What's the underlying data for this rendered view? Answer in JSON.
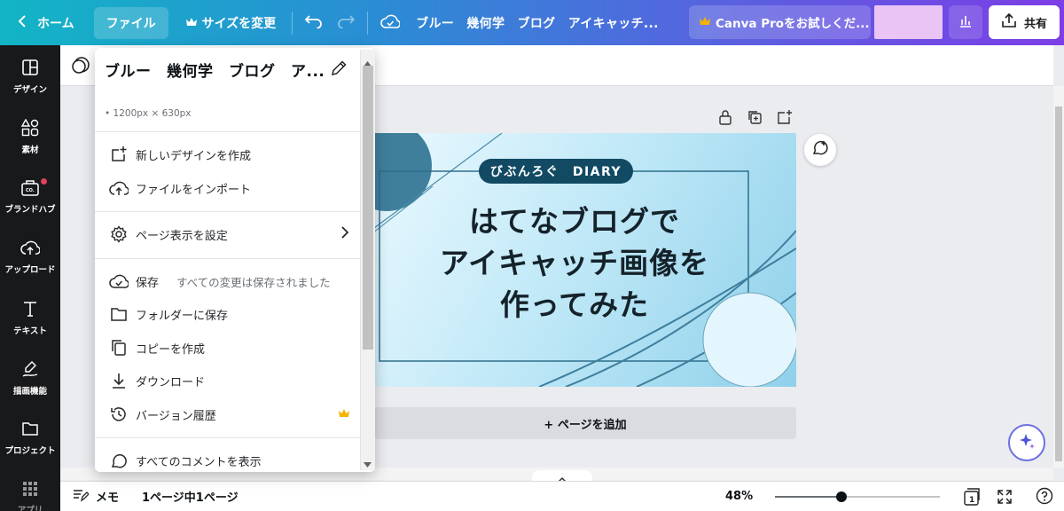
{
  "topbar": {
    "home_label": "ホーム",
    "file_label": "ファイル",
    "resize_label": "サイズを変更",
    "design_title": "ブルー　幾何学　ブログ　アイキャッチ...",
    "pro_label": "Canva Proをお試しくだ...",
    "share_label": "共有"
  },
  "sidebar": {
    "items": [
      {
        "label": "デザイン",
        "icon": "layout-icon"
      },
      {
        "label": "素材",
        "icon": "shapes-icon"
      },
      {
        "label": "ブランドハブ",
        "icon": "brand-kit-icon"
      },
      {
        "label": "アップロード",
        "icon": "upload-icon"
      },
      {
        "label": "テキスト",
        "icon": "text-icon"
      },
      {
        "label": "描画機能",
        "icon": "draw-icon"
      },
      {
        "label": "プロジェクト",
        "icon": "folder-icon"
      },
      {
        "label": "アプリ",
        "icon": "apps-icon"
      }
    ]
  },
  "menu": {
    "title": "ブルー　幾何学　ブログ　ア...",
    "size": "• 1200px × 630px",
    "items": [
      {
        "label": "新しいデザインを作成",
        "icon": "new-design-icon"
      },
      {
        "label": "ファイルをインポート",
        "icon": "import-icon"
      },
      {
        "label": "ページ表示を設定",
        "icon": "settings-icon"
      },
      {
        "label": "保存",
        "sub": "すべての変更は保存されました",
        "icon": "save-check-icon"
      },
      {
        "label": "フォルダーに保存",
        "icon": "folder-icon"
      },
      {
        "label": "コピーを作成",
        "icon": "copy-icon"
      },
      {
        "label": "ダウンロード",
        "icon": "download-icon"
      },
      {
        "label": "バージョン履歴",
        "icon": "history-icon"
      },
      {
        "label": "すべてのコメントを表示",
        "icon": "comment-icon"
      }
    ]
  },
  "design": {
    "badge": "びぶんろぐ　DIARY",
    "title_line1": "はてなブログで",
    "title_line2": "アイキャッチ画像を",
    "title_line3": "作ってみた"
  },
  "canvas": {
    "add_page_label": "+ ページを追加"
  },
  "bottombar": {
    "notes_label": "メモ",
    "page_indicator": "1ページ中1ページ",
    "zoom": "48%",
    "zoom_level": 0.48,
    "page_count": "1"
  },
  "colors": {
    "topbar_start": "#12b5c5",
    "topbar_end": "#7c3ee6",
    "sidebar_bg": "#18191b",
    "design_dark": "#124a64",
    "crown": "#f5b400"
  }
}
